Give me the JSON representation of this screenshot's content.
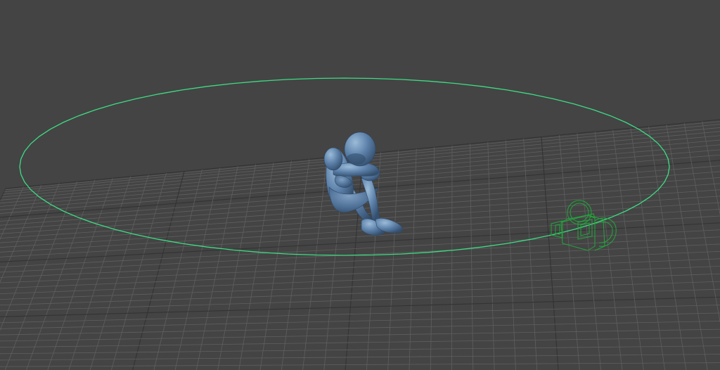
{
  "viewport": {
    "background_color": "#444444",
    "grid_color": "#5f5f5f",
    "grid_major_color": "#333333",
    "grid_divisions": 40,
    "selection_color": "#3ddc84",
    "figure_color": "#5b7fa8",
    "figure_shade_color": "#3f5c80",
    "figure_highlight_color": "#8fb0d0",
    "camera_wire_color": "#1fa83a",
    "objects": {
      "figure": "posed-mannequin-figure",
      "circle": "selected-circle-curve",
      "camera": "camera-wireframe-gizmo",
      "grid": "ground-grid-plane"
    }
  }
}
